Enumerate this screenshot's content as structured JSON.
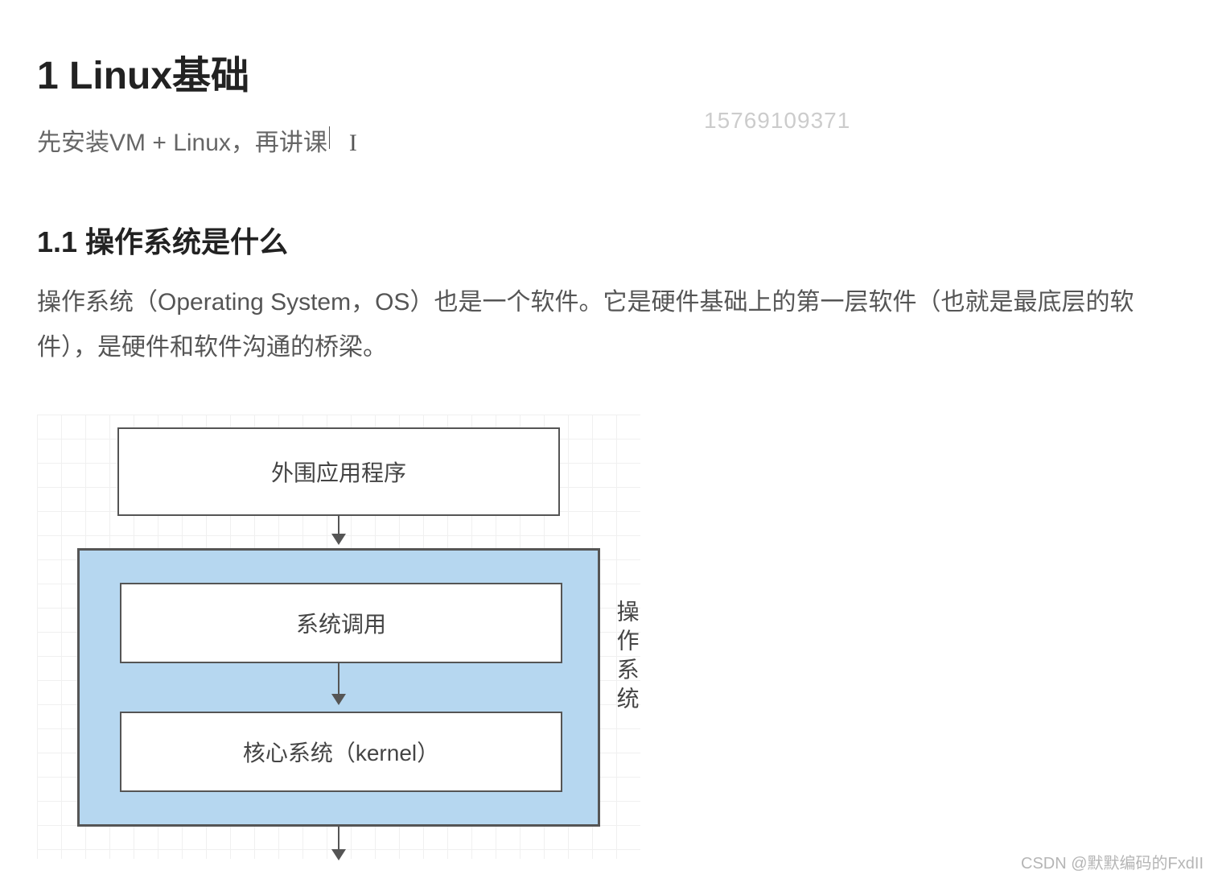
{
  "heading1": "1 Linux基础",
  "intro": "先安装VM + Linux，再讲课",
  "watermark_number": "15769109371",
  "heading2": "1.1 操作系统是什么",
  "paragraph": "操作系统（Operating System，OS）也是一个软件。它是硬件基础上的第一层软件（也就是最底层的软件），是硬件和软件沟通的桥梁。",
  "diagram": {
    "top_box": "外围应用程序",
    "mid_box": "系统调用",
    "bottom_box": "核心系统（kernel）",
    "side_label": "操作系统"
  },
  "footer": "CSDN @默默编码的FxdII"
}
